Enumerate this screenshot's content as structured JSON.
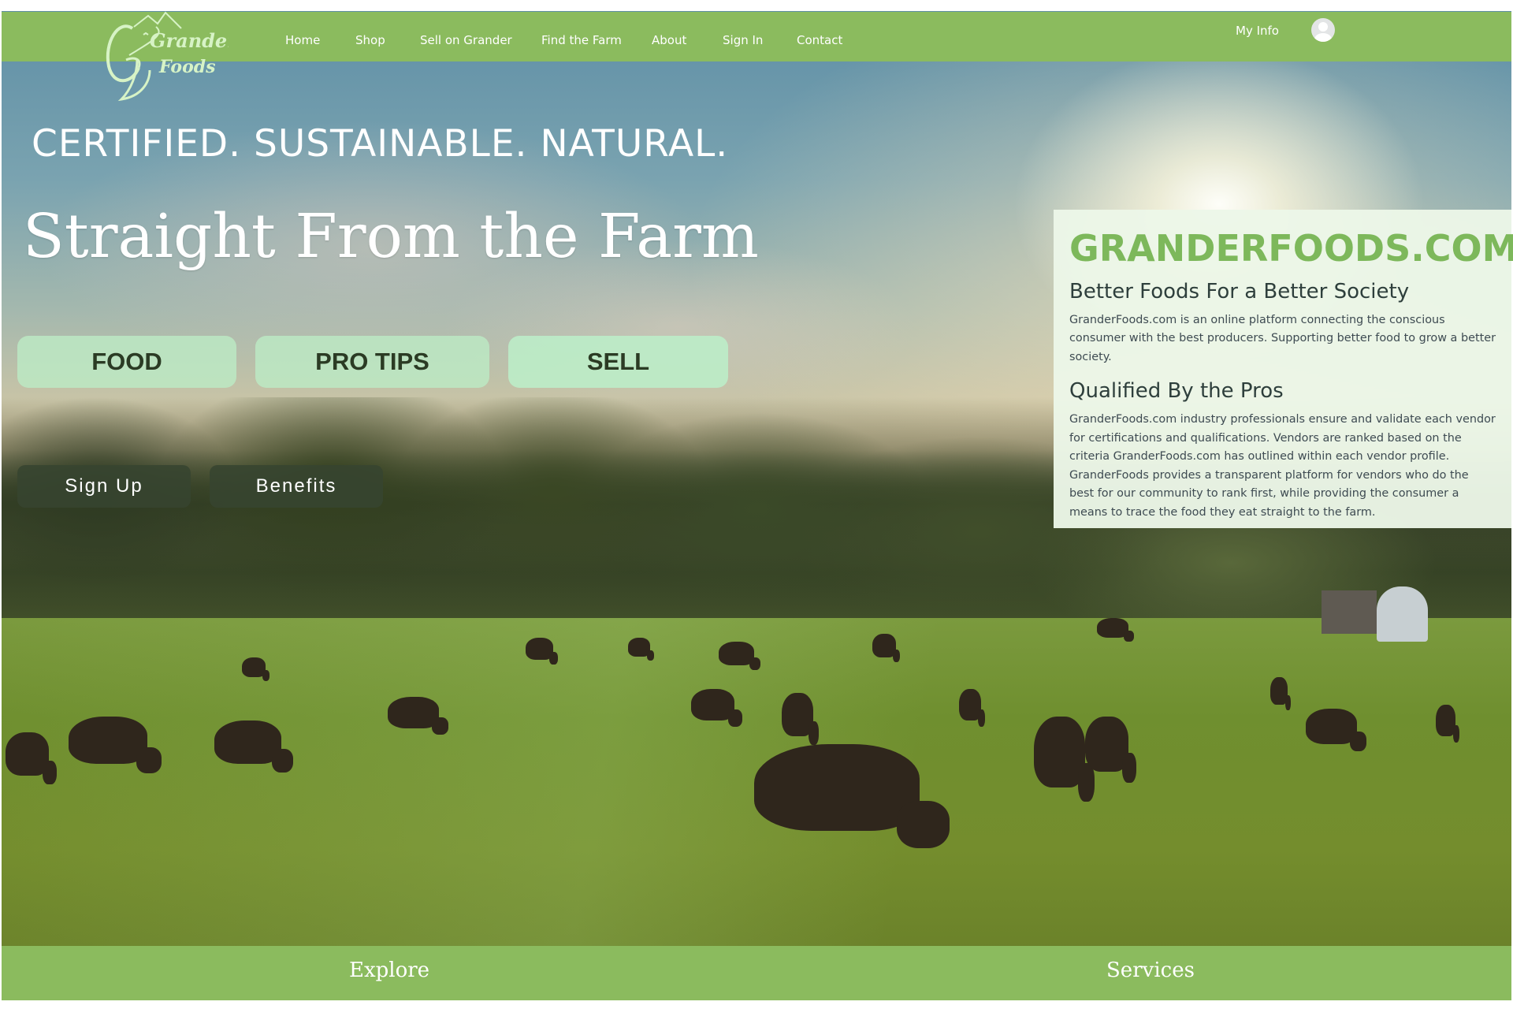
{
  "brand": {
    "logo_text_line1": "Grander",
    "logo_text_line2": "Foods",
    "logo_color": "#d7f3c6"
  },
  "nav": {
    "items": [
      {
        "label": "Home"
      },
      {
        "label": "Shop"
      },
      {
        "label": "Sell on Grander"
      },
      {
        "label": "Find the Farm"
      },
      {
        "label": "About"
      },
      {
        "label": "Sign In"
      },
      {
        "label": "Contact"
      }
    ],
    "my_info_label": "My Info",
    "avatar_icon": "user-avatar-icon",
    "bar_color": "#8bbb5e"
  },
  "hero": {
    "tagline": "CERTIFIED.  SUSTAINABLE.  NATURAL.",
    "headline": "Straight From the Farm",
    "pill_buttons": [
      {
        "label": "FOOD"
      },
      {
        "label": "PRO TIPS"
      },
      {
        "label": "SELL"
      }
    ],
    "secondary_buttons": [
      {
        "label": "Sign Up"
      },
      {
        "label": "Benefits"
      }
    ]
  },
  "info_panel": {
    "title": "GRANDERFOODS.COM",
    "title_color": "#7db85b",
    "subtitle": "Better Foods For a Better Society",
    "intro": "GranderFoods.com is an online platform connecting the conscious consumer with the best producers. Supporting better food to grow a better society.",
    "section_heading": "Qualified By the Pros",
    "section_body": "GranderFoods.com industry professionals ensure and validate each vendor for certifications and qualifications. Vendors are ranked based on the criteria GranderFoods.com has outlined within each vendor profile. GranderFoods provides a transparent platform for vendors who do the best for our community to rank first, while providing the consumer a means to trace the food they eat straight to the farm."
  },
  "footer": {
    "items": [
      {
        "label": "Explore"
      },
      {
        "label": "Services"
      }
    ]
  }
}
